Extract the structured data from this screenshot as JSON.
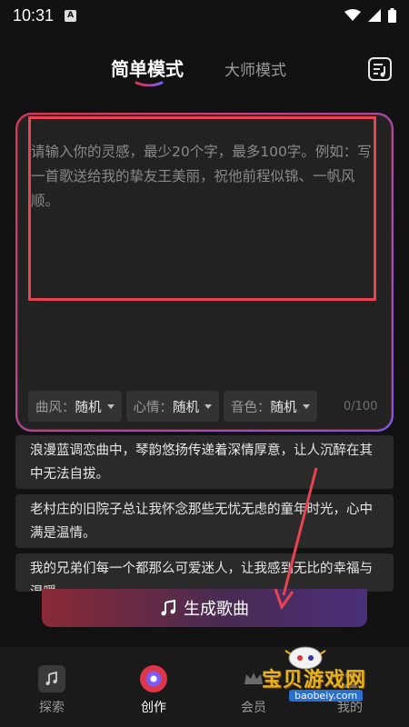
{
  "status_bar": {
    "time": "10:31",
    "notification_glyph": "A"
  },
  "header": {
    "tab_simple": "简单模式",
    "tab_master": "大师模式",
    "playlist_icon": "playlist-icon"
  },
  "input": {
    "placeholder": "请输入你的灵感，最少20个字，最多100字。例如：写一首歌送给我的挚友王美丽，祝他前程似锦、一帆风顺。",
    "counter": "0/100",
    "chips": [
      {
        "label": "曲风：",
        "value": "随机"
      },
      {
        "label": "心情：",
        "value": "随机"
      },
      {
        "label": "音色：",
        "value": "随机"
      }
    ]
  },
  "suggestions": [
    "浪漫蓝调恋曲中，琴韵悠扬传递着深情厚意，让人沉醉在其中无法自拔。",
    "老村庄的旧院子总让我怀念那些无忧无虑的童年时光，心中满是温情。",
    "我的兄弟们每一个都那么可爱迷人，让我感到无比的幸福与温暖。"
  ],
  "generate_button": {
    "label": "生成歌曲",
    "icon": "music-note-icon"
  },
  "bottom_nav": [
    {
      "label": "探索",
      "icon": "music-square-icon"
    },
    {
      "label": "创作",
      "icon": "vinyl-disc-icon"
    },
    {
      "label": "会员",
      "icon": "crown-icon"
    },
    {
      "label": "我的",
      "icon": "user-icon"
    }
  ],
  "watermark": {
    "text": "宝贝游戏网",
    "url": "baobeiy.com"
  },
  "colors": {
    "accent_purple": "#7b5cf0",
    "accent_red": "#e0344a",
    "highlight_red": "#e8434f",
    "background": "#121212"
  }
}
